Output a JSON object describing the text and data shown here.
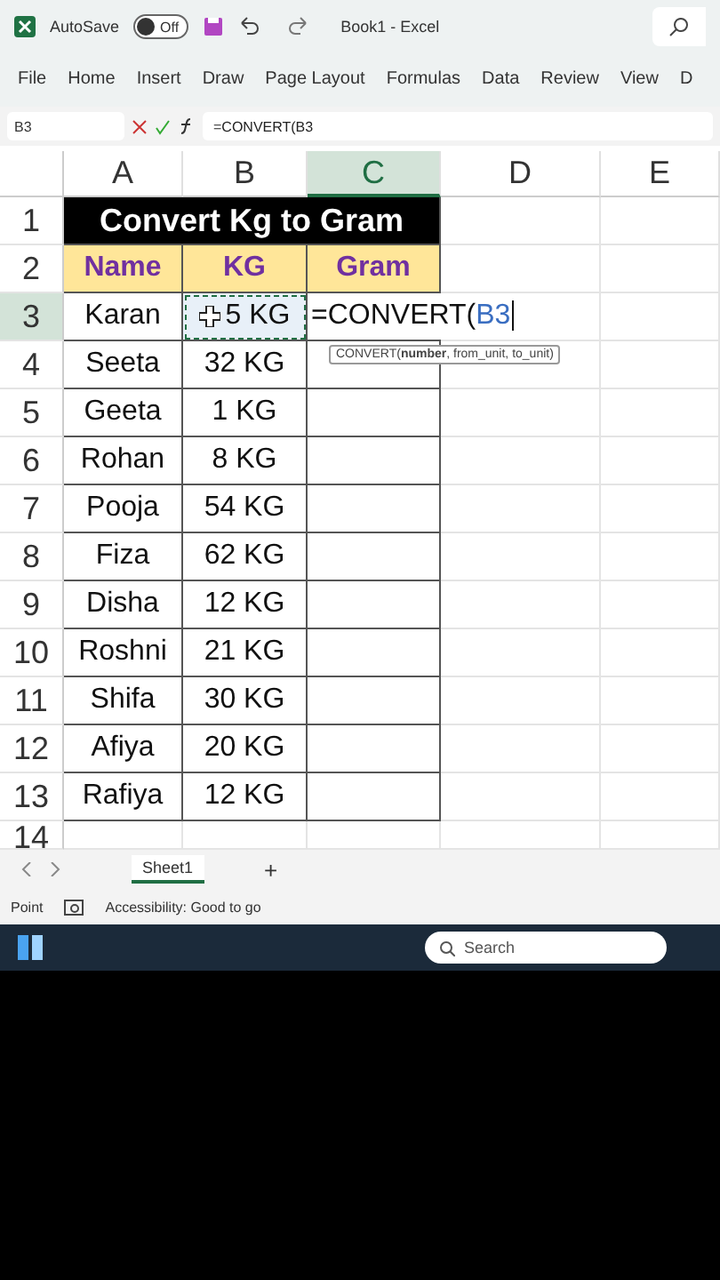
{
  "title_bar": {
    "autosave_label": "AutoSave",
    "autosave": {
      "label": "Off",
      "on": false
    },
    "title": "Book1  -  Excel"
  },
  "ribbon_tabs": [
    {
      "label": "File",
      "selected": false
    },
    {
      "label": "Home",
      "selected": false
    },
    {
      "label": "Insert",
      "selected": false
    },
    {
      "label": "Draw",
      "selected": false
    },
    {
      "label": "Page Layout",
      "selected": false
    },
    {
      "label": "Formulas",
      "selected": false
    },
    {
      "label": "Data",
      "selected": false
    },
    {
      "label": "Review",
      "selected": false
    },
    {
      "label": "View",
      "selected": false
    },
    {
      "label": "D",
      "selected": false
    }
  ],
  "formula_bar": {
    "name_box": "B3",
    "formula": "=CONVERT(B3"
  },
  "columns": [
    {
      "label": "A",
      "selected": false
    },
    {
      "label": "B",
      "selected": false
    },
    {
      "label": "C",
      "selected": true
    },
    {
      "label": "D",
      "selected": false
    },
    {
      "label": "E",
      "selected": false
    }
  ],
  "sheet": {
    "title_row": "1",
    "title": "Convert Kg to Gram",
    "header_row": "2",
    "headers": [
      "Name",
      "KG",
      "Gram"
    ],
    "rows": [
      {
        "number": "3",
        "name": "Karan",
        "kg": "5 KG",
        "selected": true,
        "editing": {
          "prefix": "=CONVERT(",
          "reference": "B3",
          "tooltip": "CONVERT(**number**, from_unit, to_unit)"
        }
      },
      {
        "number": "4",
        "name": "Seeta",
        "kg": "32 KG",
        "selected": false
      },
      {
        "number": "5",
        "name": "Geeta",
        "kg": "1 KG",
        "selected": false
      },
      {
        "number": "6",
        "name": "Rohan",
        "kg": "8 KG",
        "selected": false
      },
      {
        "number": "7",
        "name": "Pooja",
        "kg": "54 KG",
        "selected": false
      },
      {
        "number": "8",
        "name": "Fiza",
        "kg": "62 KG",
        "selected": false
      },
      {
        "number": "9",
        "name": "Disha",
        "kg": "12 KG",
        "selected": false
      },
      {
        "number": "10",
        "name": "Roshni",
        "kg": "21 KG",
        "selected": false
      },
      {
        "number": "11",
        "name": "Shifa",
        "kg": "30 KG",
        "selected": false
      },
      {
        "number": "12",
        "name": "Afiya",
        "kg": "20 KG",
        "selected": false
      },
      {
        "number": "13",
        "name": "Rafiya",
        "kg": "12 KG",
        "selected": false
      }
    ],
    "empty_rows": [
      "14"
    ]
  },
  "sheet_tabs": [
    {
      "label": "Sheet1",
      "selected": true
    }
  ],
  "add_sheet": "+",
  "status_bar": {
    "mode": "Point",
    "accessibility": "Accessibility: Good to go"
  },
  "taskbar": {
    "search_placeholder": "Search"
  }
}
